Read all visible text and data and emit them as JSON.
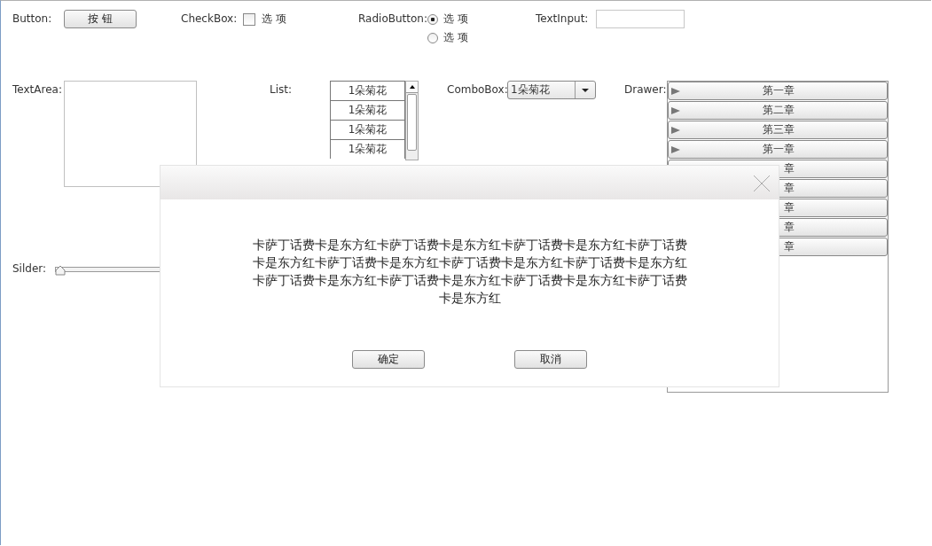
{
  "controls": {
    "button": {
      "label": "Button:",
      "text": "按 钮"
    },
    "checkbox": {
      "label": "CheckBox:",
      "text": "选 项",
      "checked": false
    },
    "radio": {
      "label": "RadioButton:",
      "options": [
        {
          "text": "选 项",
          "selected": true
        },
        {
          "text": "选 项",
          "selected": false
        }
      ]
    },
    "text_input": {
      "label": "TextInput:"
    },
    "text_area": {
      "label": "TextArea:"
    },
    "list": {
      "label": "List:",
      "items": [
        "1朵菊花",
        "1朵菊花",
        "1朵菊花",
        "1朵菊花"
      ]
    },
    "combo_box": {
      "label": "ComboBox:",
      "value": "1朵菊花"
    },
    "drawer": {
      "label": "Drawer:",
      "items": [
        {
          "label": "第一章",
          "kind": "header"
        },
        {
          "label": "第二章",
          "kind": "header"
        },
        {
          "label": "第三章",
          "kind": "header"
        },
        {
          "label": "第一章",
          "kind": "header"
        },
        {
          "label": "章",
          "kind": "covered"
        },
        {
          "label": "章",
          "kind": "covered"
        },
        {
          "label": "章",
          "kind": "covered"
        },
        {
          "label": "章",
          "kind": "covered"
        },
        {
          "label": "章",
          "kind": "covered"
        }
      ]
    },
    "slider": {
      "label": "Silder:",
      "level": 0
    }
  },
  "dialog": {
    "message": "卡萨丁话费卡是东方红卡萨丁话费卡是东方红卡萨丁话费卡是东方红卡萨丁话费卡是东方红卡萨丁话费卡是东方红卡萨丁话费卡是东方红卡萨丁话费卡是东方红卡萨丁话费卡是东方红卡萨丁话费卡是东方红卡萨丁话费卡是东方红卡萨丁话费卡是东方红",
    "buttons": [
      "确定",
      "取消"
    ]
  }
}
